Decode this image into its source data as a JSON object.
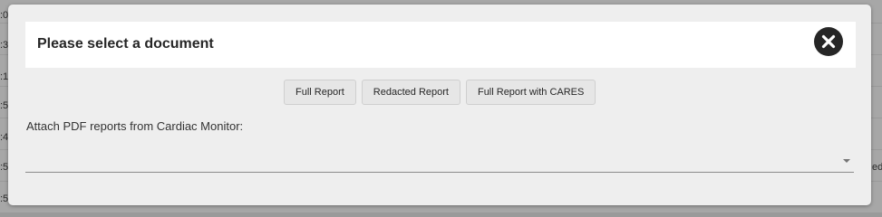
{
  "background": {
    "left_fragments": [
      ":0",
      ":3",
      ":1",
      ":5",
      ":4",
      ":5",
      ":5"
    ],
    "right_fragment": "ed"
  },
  "modal": {
    "title": "Please select a document",
    "buttons": {
      "full_report": "Full Report",
      "redacted_report": "Redacted Report",
      "full_report_cares": "Full Report with CARES"
    },
    "attach_label": "Attach PDF reports from Cardiac Monitor:",
    "attach_select_value": ""
  },
  "colors": {
    "modal_bg": "#eeeeee",
    "header_bg": "#ffffff",
    "close_button": "#262626"
  },
  "icons": {
    "close": "close-icon",
    "dropdown": "caret-down-icon"
  }
}
